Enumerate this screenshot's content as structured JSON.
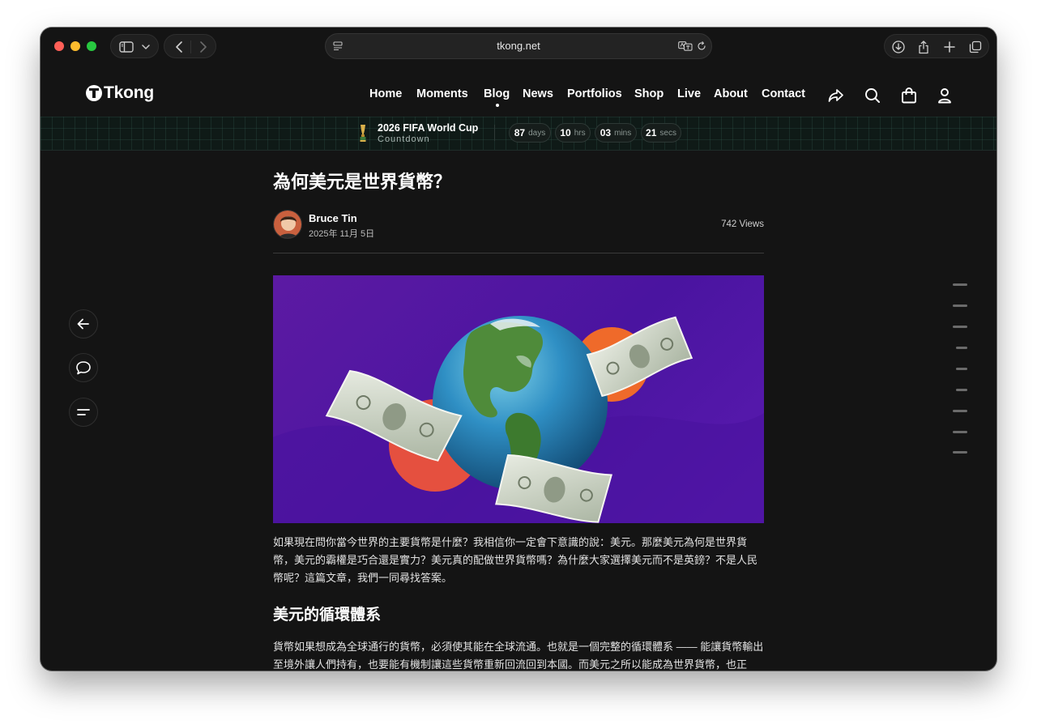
{
  "browser": {
    "url": "tkong.net"
  },
  "site": {
    "logo": "Tkong",
    "nav": [
      "Home",
      "Moments",
      "Blog",
      "News",
      "Portfolios",
      "Shop",
      "Live",
      "About",
      "Contact"
    ],
    "active_nav": "Blog"
  },
  "banner": {
    "title": "2026 FIFA World Cup",
    "subtitle": "Countdown",
    "countdown": [
      {
        "value": "87",
        "unit": "days"
      },
      {
        "value": "10",
        "unit": "hrs"
      },
      {
        "value": "03",
        "unit": "mins"
      },
      {
        "value": "21",
        "unit": "secs"
      }
    ]
  },
  "article": {
    "title": "為何美元是世界貨幣？",
    "author": "Bruce Tin",
    "date": "2025年 11月 5日",
    "views": "742 Views",
    "intro": "如果現在問你當今世界的主要貨幣是什麼？我相信你一定會下意識的說：美元。那麼美元為何是世界貨幣，美元的霸權是巧合還是實力？美元真的配做世界貨幣嗎？為什麼大家選擇美元而不是英鎊？不是人民幣呢？這篇文章，我們一同尋找答案。",
    "section_heading": "美元的循環體系",
    "section_text": "貨幣如果想成為全球通行的貨幣，必須使其能在全球流通。也就是一個完整的循環體系 —— 能讓貨幣輸出至境外讓人們持有，也要能有機制讓這些貨幣重新回流回到本國。而美元之所以能成為世界貨幣，也正"
  },
  "icons": {
    "sidebar": "sidebar-icon",
    "back": "chevron-left-icon",
    "forward": "chevron-right-icon",
    "share": "share-icon",
    "search": "search-icon",
    "bag": "shopping-bag-icon",
    "user": "user-icon",
    "side_back": "arrow-left-icon",
    "side_comment": "comment-icon",
    "side_toc": "toc-icon"
  },
  "colors": {
    "background": "#141414",
    "hero_purple": "#4f17a3",
    "accent_orange": "#ef6a2a",
    "accent_red": "#e5503f"
  }
}
